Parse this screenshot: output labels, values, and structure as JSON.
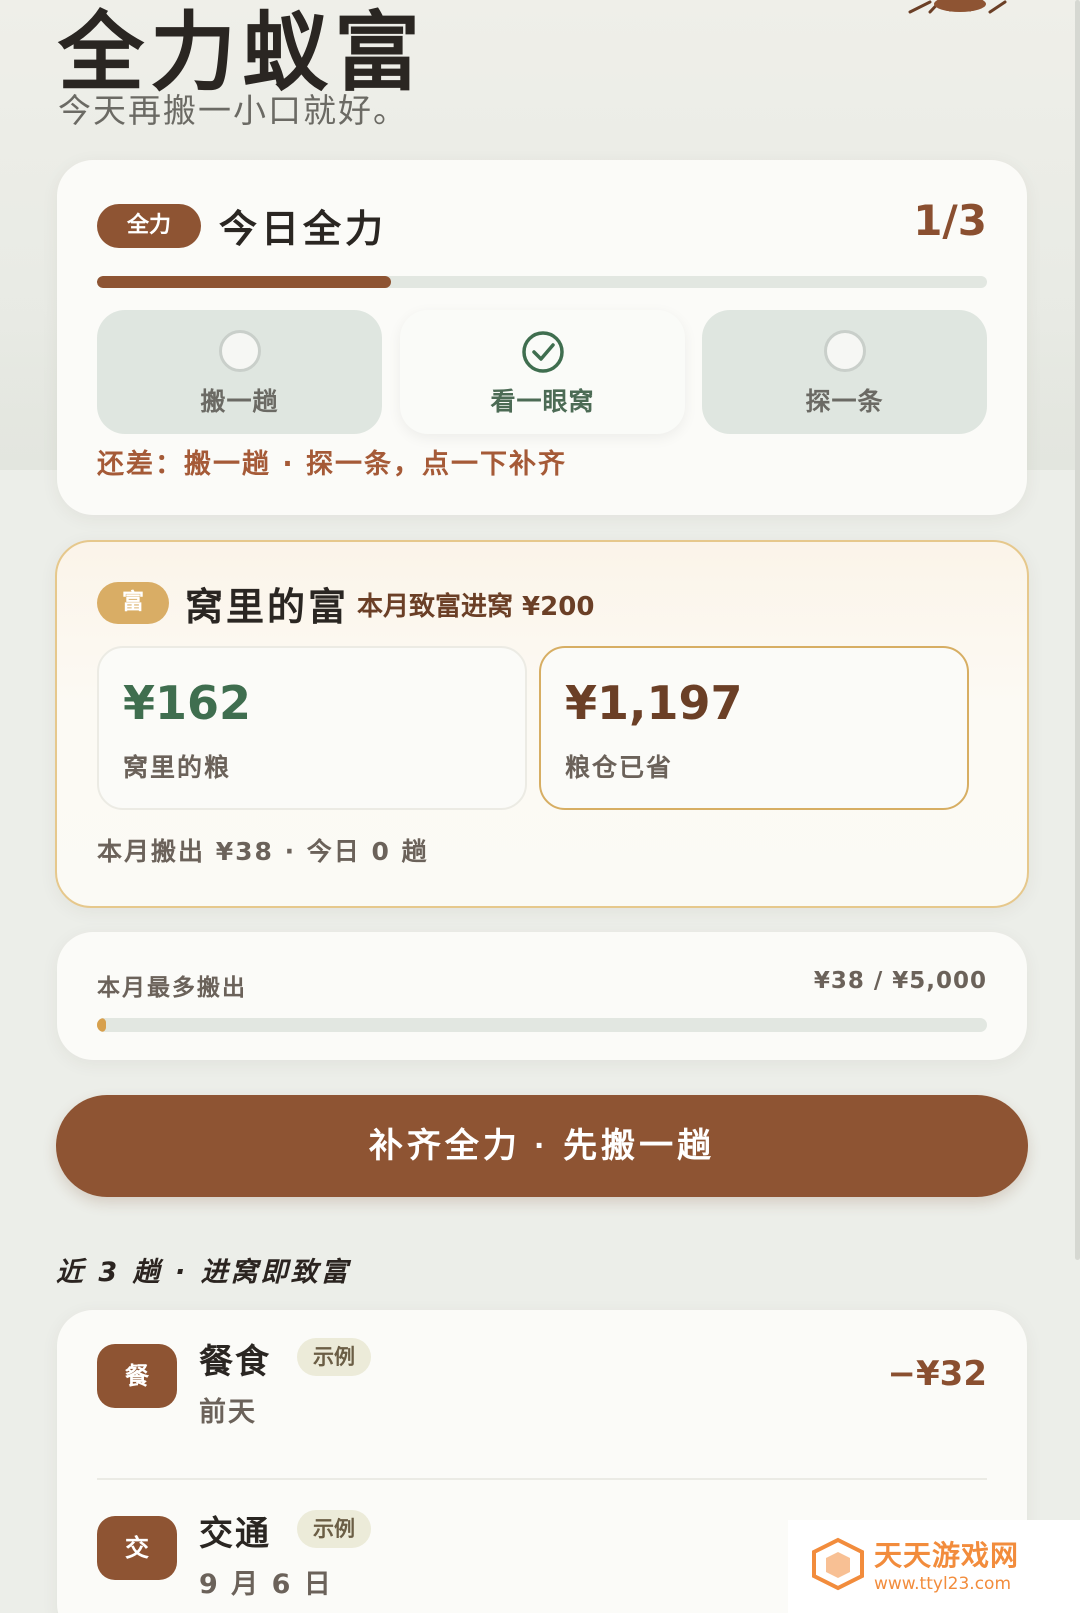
{
  "header": {
    "title": "全力蚁富",
    "subtitle": "今天再搬一小口就好。"
  },
  "daily": {
    "badge": "全力",
    "title": "今日全力",
    "count": "1/3",
    "progress": 0.33,
    "tasks": [
      {
        "label": "搬一趟",
        "done": false
      },
      {
        "label": "看一眼窝",
        "done": true
      },
      {
        "label": "探一条",
        "done": false
      }
    ],
    "missing_text": "还差：搬一趟 · 探一条，点一下补齐"
  },
  "wealth": {
    "badge": "富",
    "title": "窝里的富",
    "month_text": "本月致富进窝 ¥200",
    "stats": [
      {
        "value": "¥162",
        "label": "窝里的粮",
        "color": "#3f6e4f"
      },
      {
        "value": "¥1,197",
        "label": "粮仓已省",
        "color": "#6b3f26"
      }
    ],
    "footer": "本月搬出 ¥38 · 今日 0 趟"
  },
  "limit": {
    "label": "本月最多搬出",
    "value": "¥38 / ¥5,000",
    "progress": 0.0076
  },
  "cta": {
    "label": "补齐全力 · 先搬一趟"
  },
  "recent": {
    "title": "近 3 趟 · 进窝即致富",
    "items": [
      {
        "icon": "餐",
        "name": "餐食",
        "tag": "示例",
        "date": "前天",
        "amount": "−¥32"
      },
      {
        "icon": "交",
        "name": "交通",
        "tag": "示例",
        "date": "9 月 6 日",
        "amount": ""
      }
    ]
  },
  "watermark": {
    "text": "天天游戏网",
    "url": "www.ttyl23.com"
  },
  "colors": {
    "accent": "#8e5433",
    "gold": "#d9ad65",
    "green": "#3f6e4f",
    "warning_text": "#a55a37"
  }
}
